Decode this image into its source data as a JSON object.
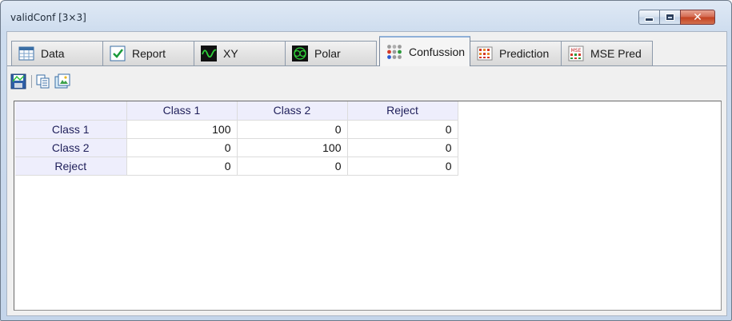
{
  "window": {
    "title": "validConf [3×3]",
    "controls": {
      "minimize": "minimize-icon",
      "maximize": "maximize-icon",
      "close": "close-icon"
    }
  },
  "tabs": [
    {
      "label": "Data",
      "icon": "data-table-icon"
    },
    {
      "label": "Report",
      "icon": "checkmark-icon"
    },
    {
      "label": "XY",
      "icon": "xy-wave-icon"
    },
    {
      "label": "Polar",
      "icon": "polar-plot-icon"
    },
    {
      "label": "Confussion",
      "icon": "confusion-dots-icon",
      "active": true
    },
    {
      "label": "Prediction",
      "icon": "prediction-grid-icon"
    },
    {
      "label": "MSE Pred",
      "icon": "mse-pred-icon"
    }
  ],
  "toolbar": [
    {
      "icon": "save-icon"
    },
    {
      "icon": "copy-icon"
    },
    {
      "icon": "export-image-icon"
    }
  ],
  "table": {
    "columns": [
      "",
      "Class 1",
      "Class 2",
      "Reject"
    ],
    "rows": [
      {
        "label": "Class 1",
        "values": [
          "100",
          "0",
          "0"
        ]
      },
      {
        "label": "Class 2",
        "values": [
          "0",
          "100",
          "0"
        ]
      },
      {
        "label": "Reject",
        "values": [
          "0",
          "0",
          "0"
        ]
      }
    ]
  },
  "colors": {
    "header_bg": "#eeeefc",
    "header_text": "#1f1f5a",
    "grid_line": "#dcdcdc",
    "close_button": "#c2401f"
  }
}
